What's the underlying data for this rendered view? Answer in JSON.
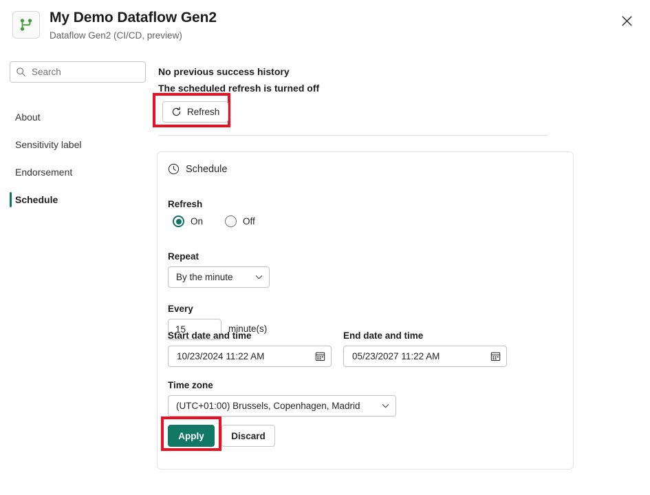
{
  "header": {
    "title": "My Demo Dataflow Gen2",
    "subtitle": "Dataflow Gen2 (CI/CD, preview)",
    "app_icon": "dataflow-icon",
    "close_label": "Close"
  },
  "sidebar": {
    "search": {
      "placeholder": "Search",
      "value": "",
      "icon": "search-icon"
    },
    "items": [
      {
        "label": "About",
        "selected": false
      },
      {
        "label": "Sensitivity label",
        "selected": false
      },
      {
        "label": "Endorsement",
        "selected": false
      },
      {
        "label": "Schedule",
        "selected": true
      }
    ]
  },
  "main": {
    "status_no_history": "No previous success history",
    "status_scheduled_off": "The scheduled refresh is turned off",
    "refresh_button": {
      "label": "Refresh",
      "icon": "refresh-icon",
      "highlighted": true
    },
    "card": {
      "heading": "Schedule",
      "heading_icon": "clock-icon",
      "refresh_label": "Refresh",
      "refresh_options": [
        {
          "label": "On",
          "selected": true
        },
        {
          "label": "Off",
          "selected": false
        }
      ],
      "repeat_label": "Repeat",
      "repeat_value": "By the minute",
      "every_label": "Every",
      "every_value": "15",
      "every_unit": "minute(s)",
      "start_label": "Start date and time",
      "start_value": "10/23/2024 11:22 AM",
      "end_label": "End date and time",
      "end_value": "05/23/2027 11:22 AM",
      "timezone_label": "Time zone",
      "timezone_value": "(UTC+01:00) Brussels, Copenhagen, Madrid",
      "apply_label": "Apply",
      "discard_label": "Discard",
      "apply_highlighted": true
    }
  },
  "colors": {
    "accent_teal": "#117865",
    "selected_bar": "#0f7362",
    "highlight_red": "#e81123",
    "icon_green": "#3f9c35",
    "text_primary": "#242424",
    "text_secondary": "#616161"
  }
}
